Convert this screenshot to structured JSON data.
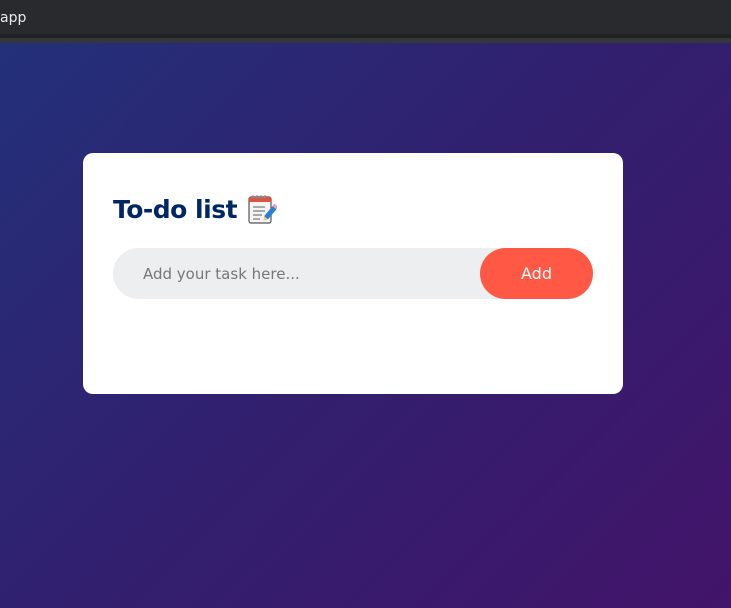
{
  "browser": {
    "tab_title": "app"
  },
  "app": {
    "title": "To-do list",
    "icon": "notepad-pencil-icon",
    "input_placeholder": "Add your task here...",
    "input_value": "",
    "add_button_label": "Add"
  },
  "colors": {
    "title": "#002765",
    "button": "#ff5945",
    "input_bg": "#edeef0",
    "bg_gradient_start": "#23307a",
    "bg_gradient_end": "#42146a"
  }
}
